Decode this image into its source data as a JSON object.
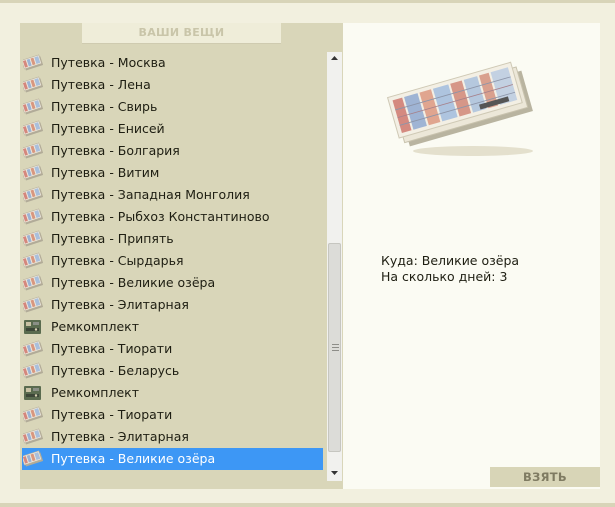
{
  "inventory": {
    "title": "ВАШИ ВЕЩИ",
    "items": [
      {
        "label": "Путевка - Москва",
        "icon": "voucher-icon"
      },
      {
        "label": "Путевка - Лена",
        "icon": "voucher-icon"
      },
      {
        "label": "Путевка - Свирь",
        "icon": "voucher-icon"
      },
      {
        "label": "Путевка - Енисей",
        "icon": "voucher-icon"
      },
      {
        "label": "Путевка - Болгария",
        "icon": "voucher-icon"
      },
      {
        "label": "Путевка - Витим",
        "icon": "voucher-icon"
      },
      {
        "label": "Путевка - Западная Монголия",
        "icon": "voucher-icon"
      },
      {
        "label": "Путевка - Рыбхоз Константиново",
        "icon": "voucher-icon"
      },
      {
        "label": "Путевка - Припять",
        "icon": "voucher-icon"
      },
      {
        "label": "Путевка - Сырдарья",
        "icon": "voucher-icon"
      },
      {
        "label": "Путевка - Великие озёра",
        "icon": "voucher-icon"
      },
      {
        "label": "Путевка - Элитарная",
        "icon": "voucher-icon"
      },
      {
        "label": "Ремкомплект",
        "icon": "repair-kit-icon"
      },
      {
        "label": "Путевка - Тиорати",
        "icon": "voucher-icon"
      },
      {
        "label": "Путевка - Беларусь",
        "icon": "voucher-icon"
      },
      {
        "label": "Ремкомплект",
        "icon": "repair-kit-icon"
      },
      {
        "label": "Путевка - Тиорати",
        "icon": "voucher-icon"
      },
      {
        "label": "Путевка - Элитарная",
        "icon": "voucher-icon"
      },
      {
        "label": "Путевка - Великие озёра",
        "icon": "voucher-icon",
        "selected": true
      }
    ]
  },
  "details": {
    "destination": "Куда: Великие озёра",
    "days": "На сколько дней: 3",
    "image_icon": "voucher-booklet-icon"
  },
  "actions": {
    "take_label": "ВЗЯТЬ"
  },
  "colors": {
    "selection": "#3d97f5",
    "panel": "#d9d6b9",
    "background": "#f2f0df"
  }
}
